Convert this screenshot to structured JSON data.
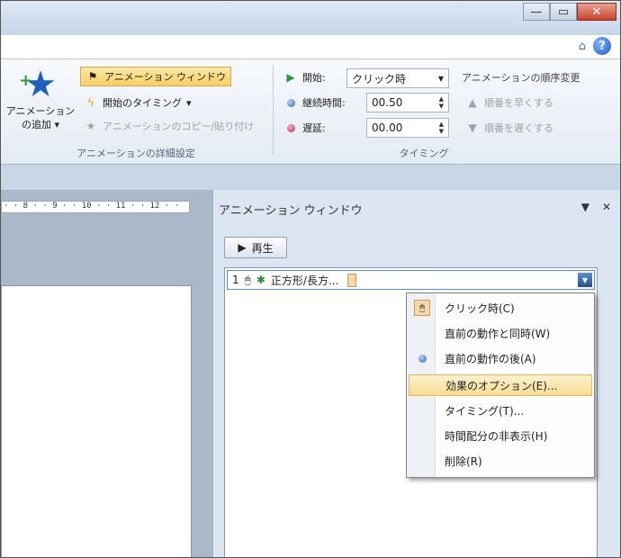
{
  "ribbon": {
    "add_animation": "アニメーションの追加",
    "add_animation_line1": "アニメーション",
    "add_animation_line2": "の追加 ▾",
    "animation_pane": "アニメーション ウィンドウ",
    "trigger": "開始のタイミング",
    "anim_painter": "アニメーションのコピー/貼り付け",
    "group_advanced": "アニメーションの詳細設定",
    "start_label": "開始:",
    "start_value": "クリック時",
    "duration_label": "継続時間:",
    "duration_value": "00.50",
    "delay_label": "遅延:",
    "delay_value": "00.00",
    "group_timing": "タイミング",
    "reorder_title": "アニメーションの順序変更",
    "move_earlier": "順番を早くする",
    "move_later": "順番を遅くする"
  },
  "ruler": "· · 8 · · 9 · · 10 · · 11 · · 12 · ·",
  "pane": {
    "title": "アニメーション ウィンドウ",
    "play_label": "再生",
    "item": {
      "number": "1",
      "name": "正方形/長方..."
    }
  },
  "menu": {
    "items": [
      {
        "label": "クリック時(C)"
      },
      {
        "label": "直前の動作と同時(W)"
      },
      {
        "label": "直前の動作の後(A)"
      },
      {
        "label": "効果のオプション(E)..."
      },
      {
        "label": "タイミング(T)..."
      },
      {
        "label": "時間配分の非表示(H)"
      },
      {
        "label": "削除(R)"
      }
    ]
  },
  "icons": {
    "star": "star-icon",
    "mouse": "mouse-icon",
    "accent": "#1f5fbf",
    "highlight": "#f8dd92"
  }
}
